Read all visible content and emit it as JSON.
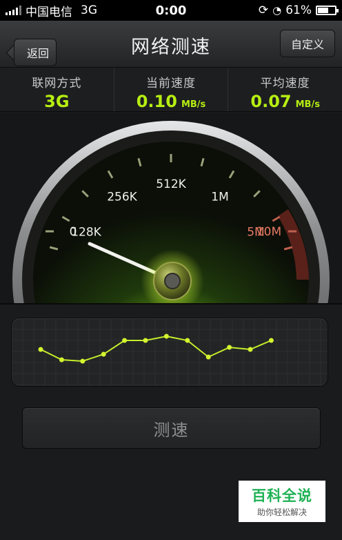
{
  "status_bar": {
    "carrier": "中国电信",
    "network": "3G",
    "time": "0:00",
    "battery": "61%",
    "battery_level": 0.61
  },
  "nav": {
    "back_label": "返回",
    "title": "网络测速",
    "custom_label": "自定义"
  },
  "stats": [
    {
      "label": "联网方式",
      "value": "3G",
      "unit": ""
    },
    {
      "label": "当前速度",
      "value": "0.10",
      "unit": "MB/s"
    },
    {
      "label": "平均速度",
      "value": "0.07",
      "unit": "MB/s"
    }
  ],
  "gauge": {
    "scale_labels": [
      "0",
      "128K",
      "256K",
      "512K",
      "1M",
      "5M",
      "10M"
    ],
    "needle_level": "128K"
  },
  "graph": {
    "values": [
      0.55,
      0.4,
      0.38,
      0.48,
      0.68,
      0.68,
      0.74,
      0.68,
      0.44,
      0.58,
      0.55,
      0.68
    ]
  },
  "test_button_label": "测速",
  "watermark": {
    "main": "百科全说",
    "sub": "助你轻松解决"
  },
  "colors": {
    "accent": "#b6ee12",
    "needle_glow": "#8ed11a",
    "red_zone": "#e87b63"
  }
}
